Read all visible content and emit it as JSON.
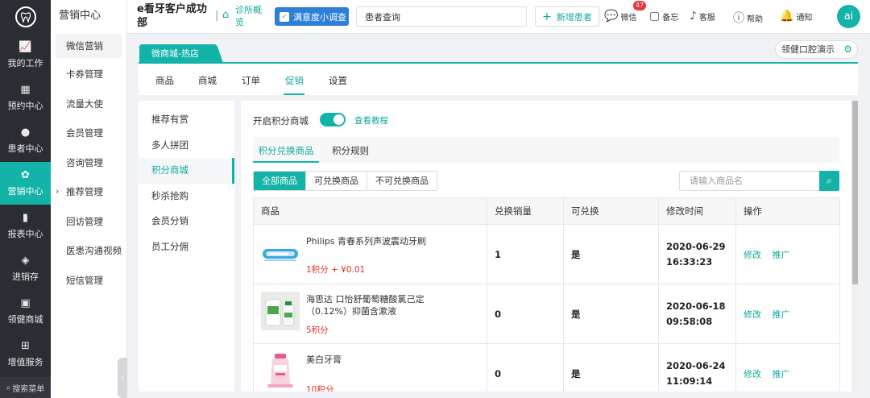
{
  "nav": {
    "logo_icon": "tooth-icon",
    "items": [
      {
        "label": "我的工作",
        "icon": "chart-icon"
      },
      {
        "label": "预约中心",
        "icon": "calendar-icon"
      },
      {
        "label": "患者中心",
        "icon": "patients-icon"
      },
      {
        "label": "营销中心",
        "icon": "flower-icon",
        "active": true
      },
      {
        "label": "报表中心",
        "icon": "bar-chart-icon"
      },
      {
        "label": "进销存",
        "icon": "layers-icon"
      },
      {
        "label": "领健商城",
        "icon": "shop-icon"
      },
      {
        "label": "增值服务",
        "icon": "grid-icon"
      }
    ],
    "search_label": "搜索菜单"
  },
  "side2": {
    "title": "营销中心",
    "items": [
      {
        "label": "微信营销",
        "active": true
      },
      {
        "label": "卡券管理"
      },
      {
        "label": "流量大使"
      },
      {
        "label": "会员管理"
      },
      {
        "label": "咨询管理"
      },
      {
        "label": "推荐管理",
        "expandable": true
      },
      {
        "label": "回访管理"
      },
      {
        "label": "医患沟通视频"
      },
      {
        "label": "短信管理"
      }
    ]
  },
  "header": {
    "clinic_name": "e看牙客户成功部",
    "overview_label": "诊所概览",
    "survey_label": "满意度小调查",
    "patient_search_value": "患者查询",
    "new_patient_label": "新增患者",
    "tools": {
      "wechat": "微信",
      "wechat_badge": "47",
      "memo": "备忘",
      "service": "客服",
      "help": "帮助",
      "notify": "通知"
    },
    "avatar_text": "ai"
  },
  "store_tab": "微商城-热店",
  "store_switch": "领健口腔演示",
  "subnav": {
    "items": [
      "商品",
      "商城",
      "订单",
      "促销",
      "设置"
    ],
    "active_index": 3
  },
  "promo_menu": {
    "items": [
      "推荐有赏",
      "多人拼团",
      "积分商城",
      "秒杀抢购",
      "会员分销",
      "员工分佣"
    ],
    "active_index": 2
  },
  "main": {
    "toggle_label": "开启积分商城",
    "toggle_on": true,
    "tutorial_link": "查看教程",
    "inner_tabs": [
      "积分兑换商品",
      "积分规则"
    ],
    "filters": [
      "全部商品",
      "可兑换商品",
      "不可兑换商品"
    ],
    "search_placeholder": "请输入商品名",
    "table": {
      "headers": [
        "商品",
        "兑换销量",
        "可兑换",
        "修改时间",
        "操作"
      ],
      "rows": [
        {
          "name": "Philips 青春系列声波震动牙刷",
          "price": "1积分 + ¥0.01",
          "sales": "1",
          "exchangeable": "是",
          "time": "2020-06-29 16:33:23",
          "ops": [
            "修改",
            "推广"
          ]
        },
        {
          "name": "海思达 口怡舒葡萄糖酸氯己定（0.12%）抑菌含漱液",
          "price": "5积分",
          "sales": "0",
          "exchangeable": "是",
          "time": "2020-06-18 09:58:08",
          "ops": [
            "修改",
            "推广"
          ]
        },
        {
          "name": "美白牙膏",
          "price": "10积分",
          "sales": "0",
          "exchangeable": "是",
          "time": "2020-06-24 11:09:14",
          "ops": [
            "修改",
            "推广"
          ]
        }
      ]
    }
  },
  "colors": {
    "accent": "#13b3a8",
    "nav_bg": "#2b2d33",
    "price_red": "#e3322b"
  }
}
